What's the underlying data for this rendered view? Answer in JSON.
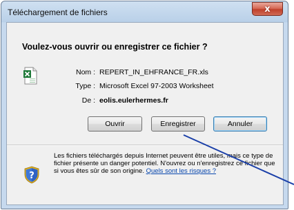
{
  "window": {
    "title": "Téléchargement de fichiers",
    "close_glyph": "x"
  },
  "dialog": {
    "question": "Voulez-vous ouvrir ou enregistrer ce fichier ?",
    "file_icon": "excel-file-icon",
    "fields": {
      "name_label": "Nom :",
      "name_value": "REPERT_IN_EHFRANCE_FR.xls",
      "type_label": "Type :",
      "type_value": "Microsoft Excel 97-2003 Worksheet",
      "from_label": "De :",
      "from_value": "eolis.eulerhermes.fr"
    },
    "buttons": {
      "open": "Ouvrir",
      "save": "Enregistrer",
      "cancel": "Annuler"
    },
    "warning": {
      "icon": "shield-question-icon",
      "text": "Les fichiers téléchargés depuis Internet peuvent être utiles, mais ce type de fichier présente un danger potentiel. N'ouvrez ou n'enregistrez ce fichier que si vous êtes sûr de son origine.",
      "link": "Quels sont les risques ?"
    }
  },
  "colors": {
    "title_bar": "#c6d9ee",
    "close_button": "#c0412b",
    "link": "#0645ad",
    "annotation_line": "#1a3fa8"
  }
}
